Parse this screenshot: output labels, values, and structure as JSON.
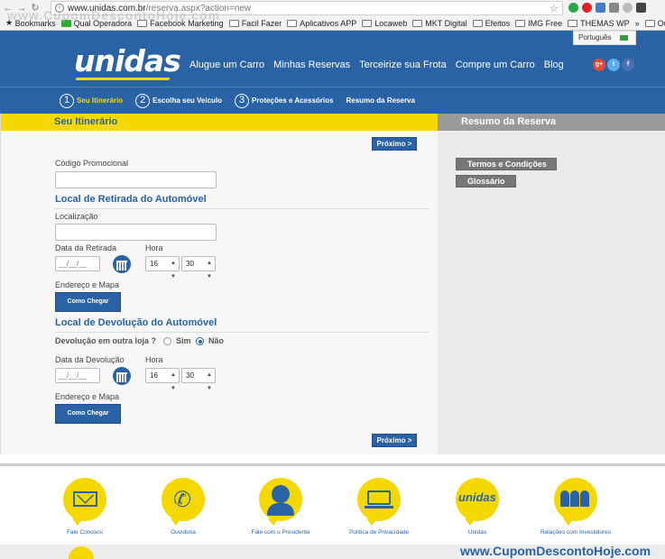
{
  "browser": {
    "url_domain": "www.unidas.com.br",
    "url_path": "/reserva.aspx?action=new",
    "bookmarks": [
      "Bookmarks",
      "Qual Operadora",
      "Facebook Marketing",
      "Facil Fazer",
      "Aplicativos APP",
      "Locaweb",
      "MKT Digital",
      "Efeitos",
      "IMG Free",
      "THEMAS WP",
      "»",
      "Outros favoritos"
    ]
  },
  "watermark": {
    "top": "www.CupomDescontoHoje.com",
    "bottom": "www.CupomDescontoHoje.com"
  },
  "header": {
    "logo": "unidas",
    "nav": [
      "Alugue um Carro",
      "Minhas Reservas",
      "Terceirize sua Frota",
      "Compre um Carro",
      "Blog"
    ],
    "language": "Português",
    "social": [
      "g+",
      "t",
      "f"
    ]
  },
  "steps": [
    {
      "num": "1",
      "label": "Seu Itinerário"
    },
    {
      "num": "2",
      "label": "Escolha seu Veículo"
    },
    {
      "num": "3",
      "label": "Proteções e Acessórios"
    },
    {
      "num": "",
      "label": "Resumo da Reserva"
    }
  ],
  "itinerary": {
    "heading": "Seu Itinerário",
    "next_label": "Próximo >",
    "promo_label": "Código Promocional",
    "pickup_title": "Local de Retirada do Automóvel",
    "location_label": "Localização",
    "pickup_date_label": "Data da Retirada",
    "time_label": "Hora",
    "date_placeholder": "__/__/__",
    "pickup_hour": "16",
    "pickup_minute": "30",
    "address_label": "Endereço e Mapa",
    "directions_label": "Como Chegar",
    "return_title": "Local de Devolução do Automóvel",
    "other_store_label": "Devolução em outra loja ?",
    "yes_label": "Sim",
    "no_label": "Não",
    "return_date_label": "Data da Devolução",
    "return_hour": "16",
    "return_minute": "30"
  },
  "summary": {
    "heading": "Resumo da Reserva",
    "terms_label": "Termos e Condições",
    "glossary_label": "Glossário"
  },
  "footer": {
    "items": [
      "Fale Conosco",
      "Ouvidoria",
      "Fale com o Presidente",
      "Política de Privacidade",
      "Unidas",
      "Relações com Investidores"
    ],
    "logo_small": "unidas"
  }
}
